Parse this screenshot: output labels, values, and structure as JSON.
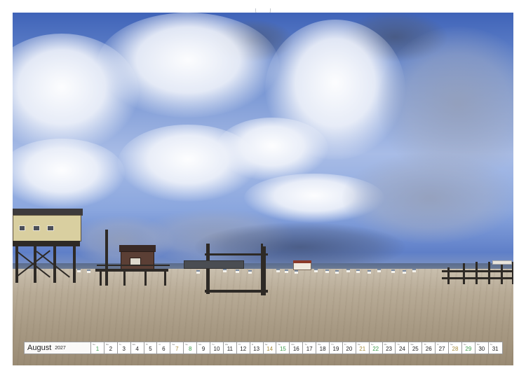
{
  "calendar": {
    "month": "August",
    "year": "2027",
    "days": [
      {
        "n": "1",
        "wd": "Su",
        "type": "sun"
      },
      {
        "n": "2",
        "wd": "Mo",
        "type": "week"
      },
      {
        "n": "3",
        "wd": "Tu",
        "type": "week"
      },
      {
        "n": "4",
        "wd": "We",
        "type": "week"
      },
      {
        "n": "5",
        "wd": "Th",
        "type": "week"
      },
      {
        "n": "6",
        "wd": "Fr",
        "type": "week"
      },
      {
        "n": "7",
        "wd": "Sa",
        "type": "sat"
      },
      {
        "n": "8",
        "wd": "Su",
        "type": "sun"
      },
      {
        "n": "9",
        "wd": "Mo",
        "type": "week"
      },
      {
        "n": "10",
        "wd": "Tu",
        "type": "week"
      },
      {
        "n": "11",
        "wd": "We",
        "type": "week"
      },
      {
        "n": "12",
        "wd": "Th",
        "type": "week"
      },
      {
        "n": "13",
        "wd": "Fr",
        "type": "week"
      },
      {
        "n": "14",
        "wd": "Sa",
        "type": "sat"
      },
      {
        "n": "15",
        "wd": "Su",
        "type": "sun"
      },
      {
        "n": "16",
        "wd": "Mo",
        "type": "week"
      },
      {
        "n": "17",
        "wd": "Tu",
        "type": "week"
      },
      {
        "n": "18",
        "wd": "We",
        "type": "week"
      },
      {
        "n": "19",
        "wd": "Th",
        "type": "week"
      },
      {
        "n": "20",
        "wd": "Fr",
        "type": "week"
      },
      {
        "n": "21",
        "wd": "Sa",
        "type": "sat"
      },
      {
        "n": "22",
        "wd": "Su",
        "type": "sun"
      },
      {
        "n": "23",
        "wd": "Mo",
        "type": "week"
      },
      {
        "n": "24",
        "wd": "Tu",
        "type": "week"
      },
      {
        "n": "25",
        "wd": "We",
        "type": "week"
      },
      {
        "n": "26",
        "wd": "Th",
        "type": "week"
      },
      {
        "n": "27",
        "wd": "Fr",
        "type": "week"
      },
      {
        "n": "28",
        "wd": "Sa",
        "type": "sat"
      },
      {
        "n": "29",
        "wd": "Su",
        "type": "sun"
      },
      {
        "n": "30",
        "wd": "Mo",
        "type": "week"
      },
      {
        "n": "31",
        "wd": "Tu",
        "type": "week"
      }
    ]
  },
  "colors": {
    "saturday": "#a58a3a",
    "sunday": "#3c9a4a",
    "sky": "#5f7fc8",
    "sand": "#b8ab96"
  }
}
